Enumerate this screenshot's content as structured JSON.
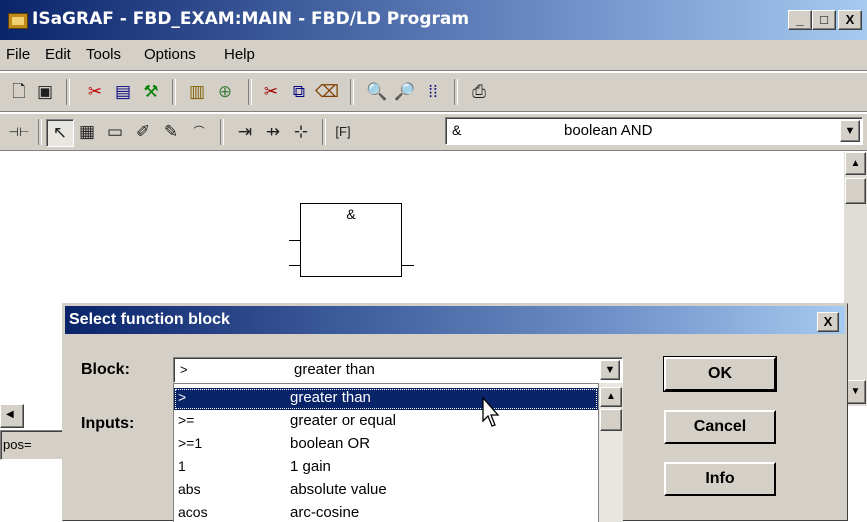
{
  "window": {
    "title": "ISaGRAF - FBD_EXAM:MAIN - FBD/LD Program",
    "min": "_",
    "max": "□",
    "close": "X"
  },
  "menu": [
    "File",
    "Edit",
    "Tools",
    "Options",
    "Help"
  ],
  "toolbar2": {
    "selected_symbol": "&",
    "selected_desc": "boolean AND"
  },
  "canvas": {
    "block_symbol": "&"
  },
  "status": {
    "text": "pos="
  },
  "dialog": {
    "title": "Select function block",
    "close": "X",
    "block_label": "Block:",
    "inputs_label": "Inputs:",
    "combo_symbol": ">",
    "combo_desc": "greater than",
    "ok": "OK",
    "cancel": "Cancel",
    "info": "Info",
    "list": [
      {
        "symbol": ">",
        "desc": "greater than",
        "selected": true
      },
      {
        "symbol": ">=",
        "desc": "greater or equal"
      },
      {
        "symbol": ">=1",
        "desc": "boolean OR"
      },
      {
        "symbol": "1",
        "desc": "1 gain"
      },
      {
        "symbol": "abs",
        "desc": "absolute value"
      },
      {
        "symbol": "acos",
        "desc": "arc-cosine"
      }
    ]
  }
}
